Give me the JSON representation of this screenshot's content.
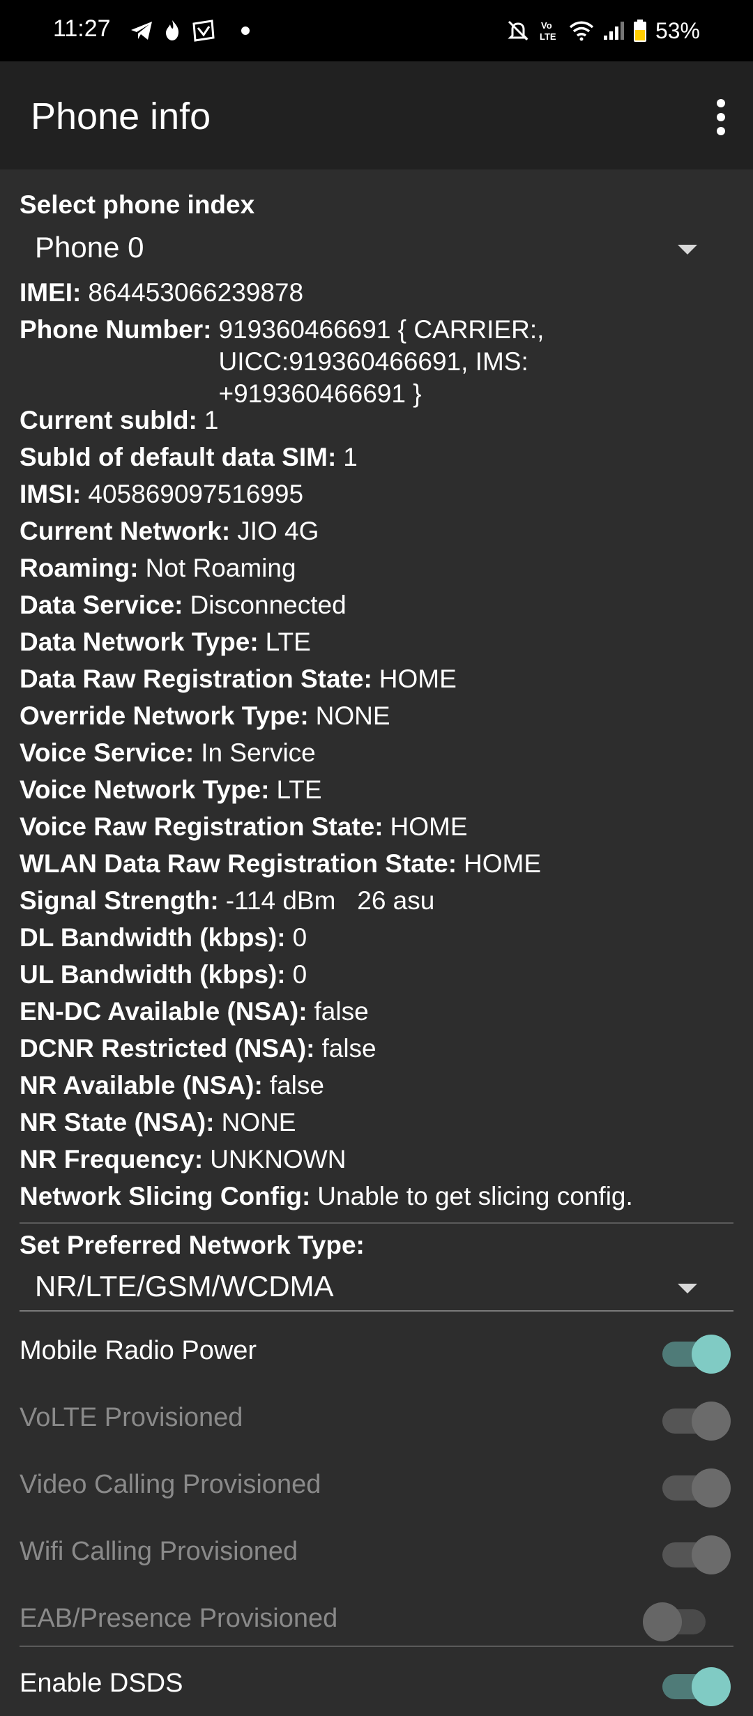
{
  "status_bar": {
    "time": "11:27",
    "battery": "53%",
    "left_icons": [
      "telegram-icon",
      "flame-icon",
      "wallet-icon",
      "dot-icon"
    ],
    "right_icons": [
      "mute-icon",
      "volte-icon",
      "wifi-icon",
      "signal-icon",
      "battery-icon"
    ],
    "volte_text": "Vo LTE"
  },
  "app_bar": {
    "title": "Phone info"
  },
  "phone_index": {
    "label": "Select phone index",
    "selected": "Phone 0"
  },
  "info": [
    {
      "key": "IMEI:",
      "value": "864453066239878"
    },
    {
      "key": "Phone Number:",
      "value": "919360466691 { CARRIER:, UICC:919360466691, IMS: +919360466691 }"
    },
    {
      "key": "Current subId:",
      "value": "1"
    },
    {
      "key": "SubId of default data SIM:",
      "value": "1"
    },
    {
      "key": "IMSI:",
      "value": "405869097516995"
    },
    {
      "key": "Current Network:",
      "value": "JIO 4G"
    },
    {
      "key": "Roaming:",
      "value": "Not Roaming"
    },
    {
      "key": "Data Service:",
      "value": "Disconnected"
    },
    {
      "key": "Data Network Type:",
      "value": "LTE"
    },
    {
      "key": "Data Raw Registration State:",
      "value": "HOME"
    },
    {
      "key": "Override Network Type:",
      "value": "NONE"
    },
    {
      "key": "Voice Service:",
      "value": "In Service"
    },
    {
      "key": "Voice Network Type:",
      "value": "LTE"
    },
    {
      "key": "Voice Raw Registration State:",
      "value": "HOME"
    },
    {
      "key": "WLAN Data Raw Registration State:",
      "value": "HOME"
    },
    {
      "key": "Signal Strength:",
      "value": "-114 dBm   26 asu"
    },
    {
      "key": "DL Bandwidth (kbps):",
      "value": "0"
    },
    {
      "key": "UL Bandwidth (kbps):",
      "value": "0"
    },
    {
      "key": "EN-DC Available (NSA):",
      "value": "false"
    },
    {
      "key": "DCNR Restricted (NSA):",
      "value": "false"
    },
    {
      "key": "NR Available (NSA):",
      "value": "false"
    },
    {
      "key": "NR State (NSA):",
      "value": "NONE"
    },
    {
      "key": "NR Frequency:",
      "value": "UNKNOWN"
    },
    {
      "key": "Network Slicing Config:",
      "value": "Unable to get slicing config."
    }
  ],
  "preferred_network": {
    "label": "Set Preferred Network Type:",
    "selected": "NR/LTE/GSM/WCDMA"
  },
  "toggles": [
    {
      "label": "Mobile Radio Power",
      "state": "on",
      "enabled": true
    },
    {
      "label": "VoLTE Provisioned",
      "state": "on",
      "enabled": false
    },
    {
      "label": "Video Calling Provisioned",
      "state": "on",
      "enabled": false
    },
    {
      "label": "Wifi Calling Provisioned",
      "state": "on",
      "enabled": false
    },
    {
      "label": "EAB/Presence Provisioned",
      "state": "off",
      "enabled": false
    },
    {
      "label": "Enable DSDS",
      "state": "on",
      "enabled": true
    }
  ]
}
